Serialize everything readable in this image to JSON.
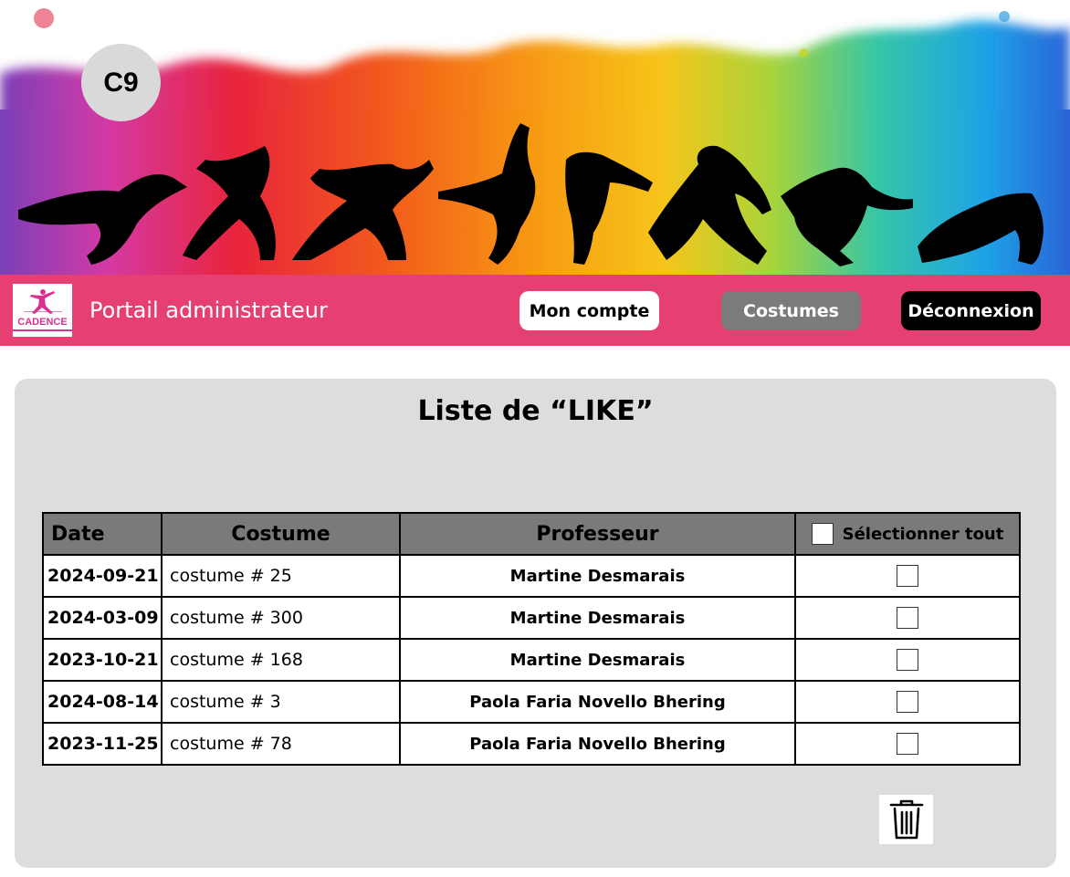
{
  "header": {
    "avatar_text": "C9",
    "logo_text": "CADENCE",
    "portal_title": "Portail administrateur",
    "nav": {
      "account_label": "Mon compte",
      "costumes_label": "Costumes",
      "logout_label": "Déconnexion"
    }
  },
  "main": {
    "title": "Liste de “LIKE”",
    "table": {
      "columns": [
        "Date",
        "Costume",
        "Professeur",
        "Sélectionner tout"
      ],
      "rows": [
        {
          "date": "2024-09-21",
          "costume": "costume # 25",
          "professeur": "Martine Desmarais",
          "checked": false
        },
        {
          "date": "2024-03-09",
          "costume": "costume # 300",
          "professeur": "Martine Desmarais",
          "checked": false
        },
        {
          "date": "2023-10-21",
          "costume": "costume # 168",
          "professeur": "Martine Desmarais",
          "checked": false
        },
        {
          "date": "2024-08-14",
          "costume": "costume # 3",
          "professeur": "Paola Faria Novello Bhering",
          "checked": false
        },
        {
          "date": "2023-11-25",
          "costume": "costume # 78",
          "professeur": "Paola Faria Novello Bhering",
          "checked": false
        }
      ]
    },
    "delete_icon": "trash-icon"
  },
  "colors": {
    "navbar": "#e64072",
    "card_background": "#dedcdd",
    "table_header": "#7a7a7a",
    "costumes_button": "#7b7b7b",
    "logout_button": "#000000",
    "logo_pink": "#d8328e"
  }
}
